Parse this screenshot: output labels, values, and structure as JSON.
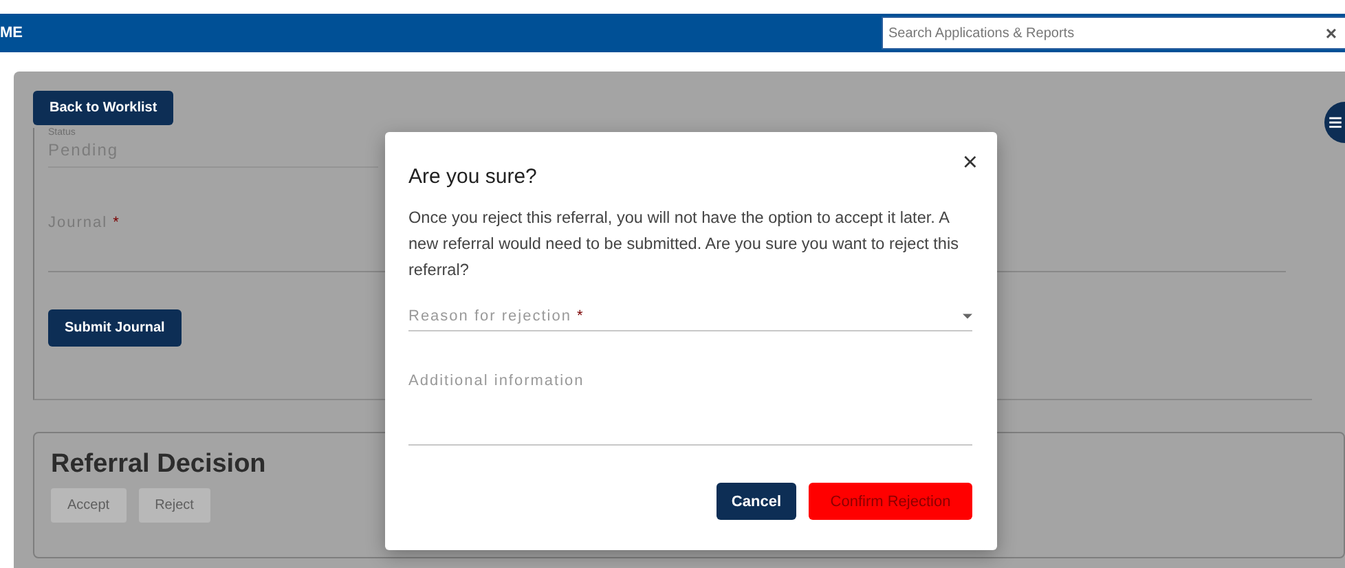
{
  "header": {
    "brand": "ME",
    "search": {
      "placeholder": "Search Applications & Reports",
      "clear": "×"
    }
  },
  "page": {
    "back_button": "Back to Worklist",
    "menu_button": "≡",
    "journal_panel": {
      "status_label": "Status",
      "status_value": "Pending",
      "journal_label": "Journal",
      "journal_required": true,
      "required_mark": "*",
      "submit_button": "Submit Journal"
    },
    "decision_panel": {
      "title": "Referral Decision",
      "buttons": [
        {
          "label": "Accept",
          "disabled": true
        },
        {
          "label": "Reject",
          "disabled": true
        }
      ]
    }
  },
  "dialog": {
    "title": "Are you sure?",
    "close": "×",
    "message": "Once you reject this referral, you will not have the option to accept it later. A new referral would need to be submitted. Are you sure you want to reject this referral?",
    "required_mark": "*",
    "fields": [
      {
        "kind": "select",
        "label": "Reason for rejection",
        "required": true
      },
      {
        "kind": "text",
        "label": "Additional information",
        "required": false
      }
    ],
    "buttons": [
      {
        "kind": "secondary",
        "label": "Cancel"
      },
      {
        "kind": "danger",
        "label": "Confirm Rejection"
      }
    ]
  }
}
